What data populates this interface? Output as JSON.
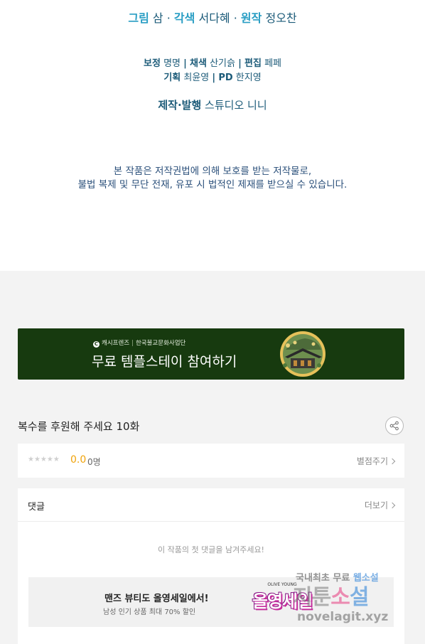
{
  "credits": {
    "line1": {
      "art_role": "그림",
      "art_name": "삼",
      "adapt_role": "각색",
      "adapt_name": "서다혜",
      "original_role": "원작",
      "original_name": "정오찬",
      "separator": "·"
    },
    "line2": {
      "correction_role": "보정",
      "correction_name": "명명",
      "color_role": "채색",
      "color_name": "산기슭",
      "edit_role": "편집",
      "edit_name": "페페",
      "pipe": "|"
    },
    "line3": {
      "planning_role": "기획",
      "planning_name": "최윤영",
      "pd_role": "PD",
      "pd_name": "한지영",
      "pipe": "|"
    },
    "line4": {
      "production_role": "제작·발행",
      "production_name": "스튜디오 니니"
    },
    "copyright_line1": "본 작품은 저작권법에 의해 보호를 받는 저작물로,",
    "copyright_line2": "불법 복제 및 무단 전재, 유포 시 법적인 제재를 받으실 수 있습니다."
  },
  "banner": {
    "logo_letter": "C",
    "sponsor1": "캐시프렌즈",
    "pipe": "|",
    "sponsor2": "한국불교문화사업단",
    "title": "무료 템플스테이 참여하기",
    "bg_color": "#173a0f"
  },
  "episode": {
    "title": "복수를 후원해 주세요 10화",
    "share_icon": "share-icon"
  },
  "rating": {
    "stars": "★★★★★",
    "score": "0.0",
    "count": "0명",
    "rate_label": "별점주기",
    "score_color": "#f0a30a"
  },
  "comments": {
    "title": "댓글",
    "more_label": "더보기",
    "empty_message": "이 작품의 첫 댓글을 남겨주세요!"
  },
  "ad": {
    "title": "맨즈 뷰티도 올영세일에서!",
    "subtitle": "남성 인기 상품 최대 70% 할인",
    "logo_text": "올영세일",
    "logo_tag": "OLIVE YOUNG"
  },
  "watermark": {
    "top_gray": "국내최초 무료",
    "top_blue": "웹소설",
    "mid_gray": "지툰",
    "mid_pink": "소",
    "mid_blue": "설",
    "bottom": "novelagit.xyz"
  }
}
